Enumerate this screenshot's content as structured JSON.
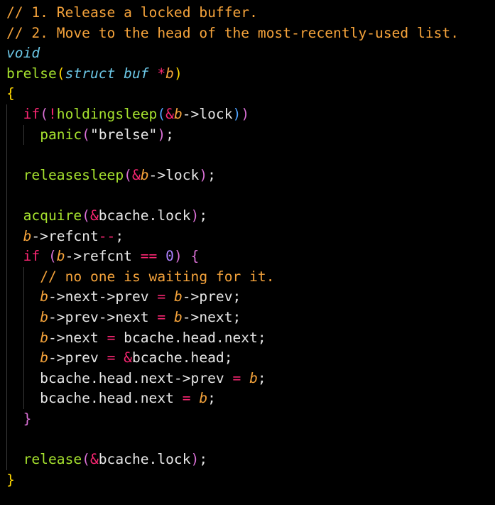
{
  "editor": {
    "background": "#000000",
    "colors": {
      "comment": "#f5a33b",
      "type": "#6cc7e6",
      "function": "#a6e22e",
      "keyword": "#f92672",
      "param": "#f5a33b",
      "operator": "#f92672",
      "plain": "#e6e6e6",
      "number": "#ae81ff",
      "brace_level1": "#ffd700",
      "brace_level2": "#da70d6",
      "brace_level3": "#4fa3ff"
    },
    "lines": [
      [
        {
          "t": "comment",
          "v": "// 1. Release a locked buffer."
        }
      ],
      [
        {
          "t": "comment",
          "v": "// 2. Move to the head of the most-recently-used list."
        }
      ],
      [
        {
          "t": "type",
          "v": "void"
        }
      ],
      [
        {
          "t": "func",
          "v": "brelse"
        },
        {
          "t": "brace-y",
          "v": "("
        },
        {
          "t": "type",
          "v": "struct"
        },
        {
          "t": "plain",
          "v": " "
        },
        {
          "t": "type",
          "v": "buf"
        },
        {
          "t": "plain",
          "v": " "
        },
        {
          "t": "op",
          "v": "*"
        },
        {
          "t": "param",
          "v": "b"
        },
        {
          "t": "brace-y",
          "v": ")"
        }
      ],
      [
        {
          "t": "brace-y",
          "v": "{"
        }
      ],
      [
        {
          "t": "plain",
          "v": "  "
        },
        {
          "t": "keyword",
          "v": "if"
        },
        {
          "t": "brace-m",
          "v": "("
        },
        {
          "t": "op",
          "v": "!"
        },
        {
          "t": "func",
          "v": "holdingsleep"
        },
        {
          "t": "brace-b",
          "v": "("
        },
        {
          "t": "op",
          "v": "&"
        },
        {
          "t": "param",
          "v": "b"
        },
        {
          "t": "plain",
          "v": "->lock"
        },
        {
          "t": "brace-b",
          "v": ")"
        },
        {
          "t": "brace-m",
          "v": ")"
        }
      ],
      [
        {
          "t": "plain",
          "v": "    "
        },
        {
          "t": "func",
          "v": "panic"
        },
        {
          "t": "brace-m",
          "v": "("
        },
        {
          "t": "string",
          "v": "\"brelse\""
        },
        {
          "t": "brace-m",
          "v": ")"
        },
        {
          "t": "plain",
          "v": ";"
        }
      ],
      [],
      [
        {
          "t": "plain",
          "v": "  "
        },
        {
          "t": "func",
          "v": "releasesleep"
        },
        {
          "t": "brace-m",
          "v": "("
        },
        {
          "t": "op",
          "v": "&"
        },
        {
          "t": "param",
          "v": "b"
        },
        {
          "t": "plain",
          "v": "->lock"
        },
        {
          "t": "brace-m",
          "v": ")"
        },
        {
          "t": "plain",
          "v": ";"
        }
      ],
      [],
      [
        {
          "t": "plain",
          "v": "  "
        },
        {
          "t": "func",
          "v": "acquire"
        },
        {
          "t": "brace-m",
          "v": "("
        },
        {
          "t": "op",
          "v": "&"
        },
        {
          "t": "plain",
          "v": "bcache.lock"
        },
        {
          "t": "brace-m",
          "v": ")"
        },
        {
          "t": "plain",
          "v": ";"
        }
      ],
      [
        {
          "t": "plain",
          "v": "  "
        },
        {
          "t": "param",
          "v": "b"
        },
        {
          "t": "plain",
          "v": "->refcnt"
        },
        {
          "t": "op",
          "v": "--"
        },
        {
          "t": "plain",
          "v": ";"
        }
      ],
      [
        {
          "t": "plain",
          "v": "  "
        },
        {
          "t": "keyword",
          "v": "if"
        },
        {
          "t": "plain",
          "v": " "
        },
        {
          "t": "brace-m",
          "v": "("
        },
        {
          "t": "param",
          "v": "b"
        },
        {
          "t": "plain",
          "v": "->refcnt "
        },
        {
          "t": "op",
          "v": "=="
        },
        {
          "t": "plain",
          "v": " "
        },
        {
          "t": "num",
          "v": "0"
        },
        {
          "t": "brace-m",
          "v": ")"
        },
        {
          "t": "plain",
          "v": " "
        },
        {
          "t": "brace-m",
          "v": "{"
        }
      ],
      [
        {
          "t": "plain",
          "v": "    "
        },
        {
          "t": "comment",
          "v": "// no one is waiting for it."
        }
      ],
      [
        {
          "t": "plain",
          "v": "    "
        },
        {
          "t": "param",
          "v": "b"
        },
        {
          "t": "plain",
          "v": "->next->prev "
        },
        {
          "t": "op",
          "v": "="
        },
        {
          "t": "plain",
          "v": " "
        },
        {
          "t": "param",
          "v": "b"
        },
        {
          "t": "plain",
          "v": "->prev;"
        }
      ],
      [
        {
          "t": "plain",
          "v": "    "
        },
        {
          "t": "param",
          "v": "b"
        },
        {
          "t": "plain",
          "v": "->prev->next "
        },
        {
          "t": "op",
          "v": "="
        },
        {
          "t": "plain",
          "v": " "
        },
        {
          "t": "param",
          "v": "b"
        },
        {
          "t": "plain",
          "v": "->next;"
        }
      ],
      [
        {
          "t": "plain",
          "v": "    "
        },
        {
          "t": "param",
          "v": "b"
        },
        {
          "t": "plain",
          "v": "->next "
        },
        {
          "t": "op",
          "v": "="
        },
        {
          "t": "plain",
          "v": " bcache.head.next;"
        }
      ],
      [
        {
          "t": "plain",
          "v": "    "
        },
        {
          "t": "param",
          "v": "b"
        },
        {
          "t": "plain",
          "v": "->prev "
        },
        {
          "t": "op",
          "v": "="
        },
        {
          "t": "plain",
          "v": " "
        },
        {
          "t": "op",
          "v": "&"
        },
        {
          "t": "plain",
          "v": "bcache.head;"
        }
      ],
      [
        {
          "t": "plain",
          "v": "    bcache.head.next->prev "
        },
        {
          "t": "op",
          "v": "="
        },
        {
          "t": "plain",
          "v": " "
        },
        {
          "t": "param",
          "v": "b"
        },
        {
          "t": "plain",
          "v": ";"
        }
      ],
      [
        {
          "t": "plain",
          "v": "    bcache.head.next "
        },
        {
          "t": "op",
          "v": "="
        },
        {
          "t": "plain",
          "v": " "
        },
        {
          "t": "param",
          "v": "b"
        },
        {
          "t": "plain",
          "v": ";"
        }
      ],
      [
        {
          "t": "plain",
          "v": "  "
        },
        {
          "t": "brace-m",
          "v": "}"
        }
      ],
      [],
      [
        {
          "t": "plain",
          "v": "  "
        },
        {
          "t": "func",
          "v": "release"
        },
        {
          "t": "brace-m",
          "v": "("
        },
        {
          "t": "op",
          "v": "&"
        },
        {
          "t": "plain",
          "v": "bcache.lock"
        },
        {
          "t": "brace-m",
          "v": ")"
        },
        {
          "t": "plain",
          "v": ";"
        }
      ],
      [
        {
          "t": "brace-y",
          "v": "}"
        }
      ]
    ]
  }
}
